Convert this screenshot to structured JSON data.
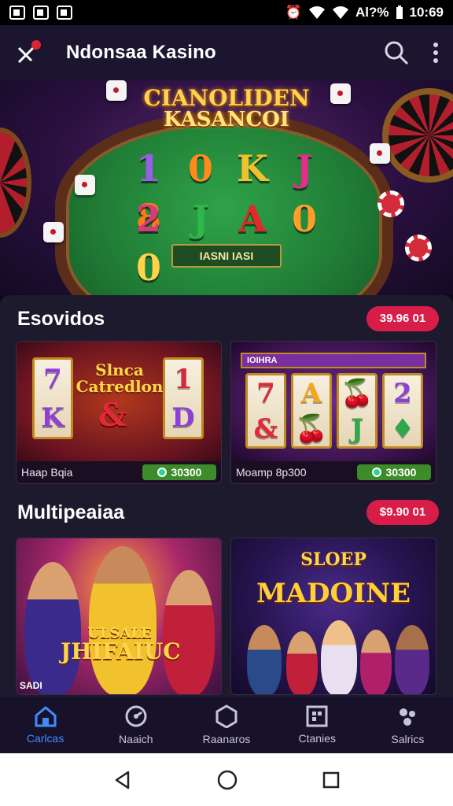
{
  "status_bar": {
    "time": "10:69",
    "signal_text": "Al?%",
    "glyphs": [
      "alarm-icon",
      "wifi-icon",
      "signal-icon",
      "battery-icon"
    ]
  },
  "app_bar": {
    "title": "Ndonsaa Kasino",
    "icons": [
      "logo-icon",
      "search-icon",
      "more-vert-icon"
    ]
  },
  "hero": {
    "title_line1": "CIANOLIDEN",
    "title_line2": "KASANCOI",
    "tiles": [
      "1",
      "0",
      "K",
      "J",
      "8",
      "2",
      "J",
      "A",
      "0",
      "0"
    ],
    "tile_colors": [
      "#9b5de5",
      "#ff8a1a",
      "#f2c12e",
      "#e0308a",
      "#ff7a1a",
      "#d63b7c",
      "#2fb84a",
      "#e02a2a",
      "#ff9d2a",
      "#ffd44a"
    ],
    "button_label": "IASNI IASI"
  },
  "section1": {
    "heading": "Esovidos",
    "pill": "39.96 01",
    "cards": [
      {
        "banner": "Slnca Catredlon",
        "reels": [
          "7",
          "🍒",
          "1",
          "K",
          "&",
          "D"
        ],
        "label": "Haap Bqia",
        "value": "30300"
      },
      {
        "banner": "IOIHRA",
        "reels": [
          "7",
          "A",
          "🍒",
          "2",
          "&",
          "🍒",
          "J",
          "♦"
        ],
        "label": "Moamp 8p300",
        "value": "30300"
      }
    ]
  },
  "section2": {
    "heading": "Multipeaiaa",
    "pill": "$9.90 01",
    "cards": [
      {
        "banner_line1": "ULSALE",
        "banner_line2": "JHIFAIUC",
        "label": "SADI"
      },
      {
        "banner_line1": "SLOEP",
        "banner_line2": "MADOINE",
        "label": ""
      }
    ]
  },
  "bottom_nav": [
    {
      "label": "Carlcas",
      "icon": "home-icon",
      "active": true
    },
    {
      "label": "Naaich",
      "icon": "timer-icon",
      "active": false
    },
    {
      "label": "Raanaros",
      "icon": "hexagon-icon",
      "active": false
    },
    {
      "label": "Ctanies",
      "icon": "grid-icon",
      "active": false
    },
    {
      "label": "Salrics",
      "icon": "settings-icon",
      "active": false
    }
  ],
  "colors": {
    "accent": "#3f8cff",
    "pill": "#d81e48",
    "panel": "#1e1a2e",
    "value_chip": "#3d8b2a"
  }
}
